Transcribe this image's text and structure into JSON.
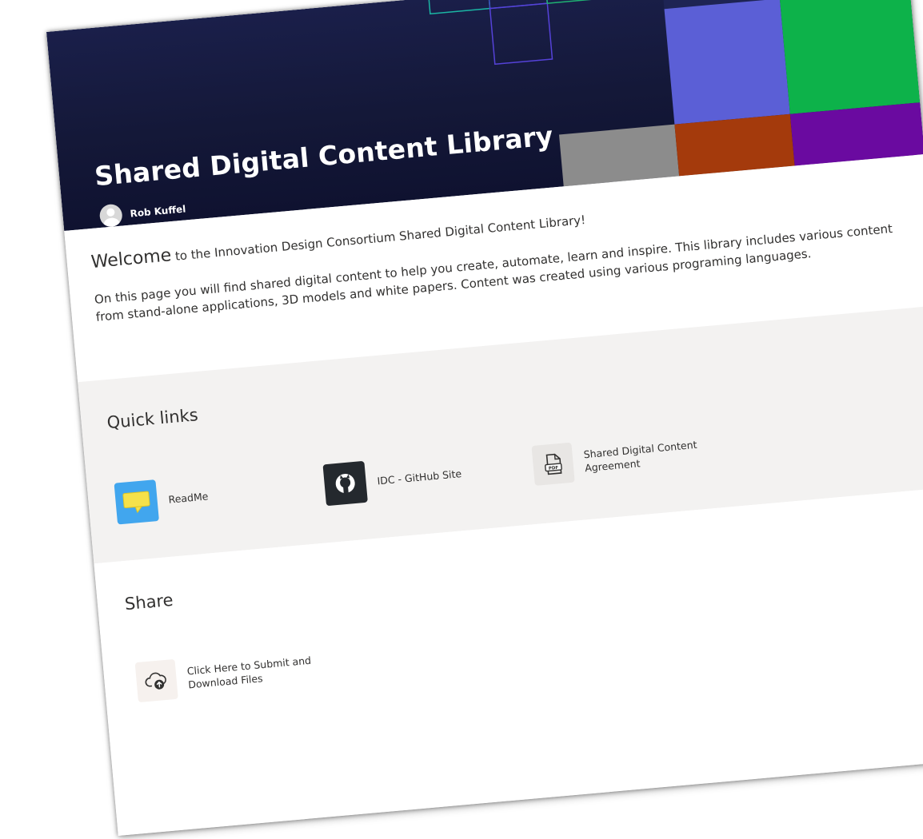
{
  "banner": {
    "title": "Shared Digital Content Library",
    "author": "Rob Kuffel",
    "colors": {
      "background": "#141838",
      "tile_purple": "#5b5fd6",
      "tile_green": "#0db24a",
      "tile_teal": "#13e0c2",
      "tile_gray": "#8c8c8c",
      "tile_rust": "#a43a0c",
      "tile_violet": "#6a0aa0"
    }
  },
  "welcome": {
    "lead_word": "Welcome",
    "lead_rest": " to the Innovation Design Consortium Shared Digital Content Library!",
    "paragraph": "On this page you will find shared digital content to help you create, automate, learn and inspire. This library includes various content from stand-alone applications, 3D models and white papers. Content was created using various programing languages."
  },
  "quick_links": {
    "title": "Quick links",
    "items": [
      {
        "label": "ReadMe",
        "icon": "speech-bubble-icon"
      },
      {
        "label": "IDC - GitHub Site",
        "icon": "github-icon"
      },
      {
        "label": "Shared Digital Content Agreement",
        "icon": "pdf-document-icon"
      }
    ]
  },
  "share": {
    "title": "Share",
    "item": {
      "label": "Click Here to Submit and Download Files",
      "icon": "cloud-upload-icon"
    }
  }
}
